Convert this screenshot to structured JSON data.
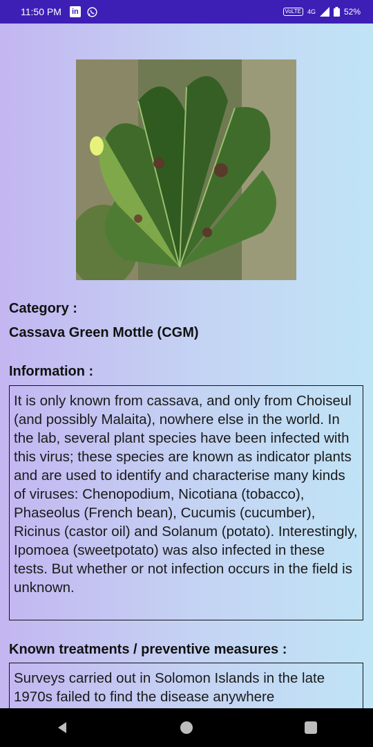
{
  "status_bar": {
    "time": "11:50 PM",
    "left_icons": [
      "linkedin-icon",
      "whatsapp-icon"
    ],
    "volte": "VoLTE",
    "network": "4G",
    "battery": "52%"
  },
  "detail": {
    "image_alt": "cassava-leaf-photo",
    "category_label": "Category :",
    "category_value": "Cassava Green Mottle (CGM)",
    "information_label": "Information :",
    "information_text": "It is only known from cassava, and only from Choiseul (and possibly Malaita), nowhere else in the world. In the lab, several plant species have been infected with this virus; these species are known as indicator plants and are used to identify and characterise many kinds of viruses: Chenopodium, Nicotiana (tobacco), Phaseolus (French bean), Cucumis (cucumber), Ricinus (castor oil) and Solanum (potato). Interestingly, Ipomoea (sweetpotato) was also infected in these tests. But whether or not infection occurs in the field is unknown.",
    "treatments_label": "Known treatments / preventive measures :",
    "treatments_text": "Surveys carried out in Solomon Islands in the late 1970s failed to find the disease anywhere"
  },
  "nav_bar": {
    "icons": [
      "back-icon",
      "home-icon",
      "recents-icon"
    ]
  },
  "colors": {
    "status_bar": "#3d1fb6",
    "bg_left": "#c3b6f1",
    "bg_right": "#c0e4f6"
  }
}
